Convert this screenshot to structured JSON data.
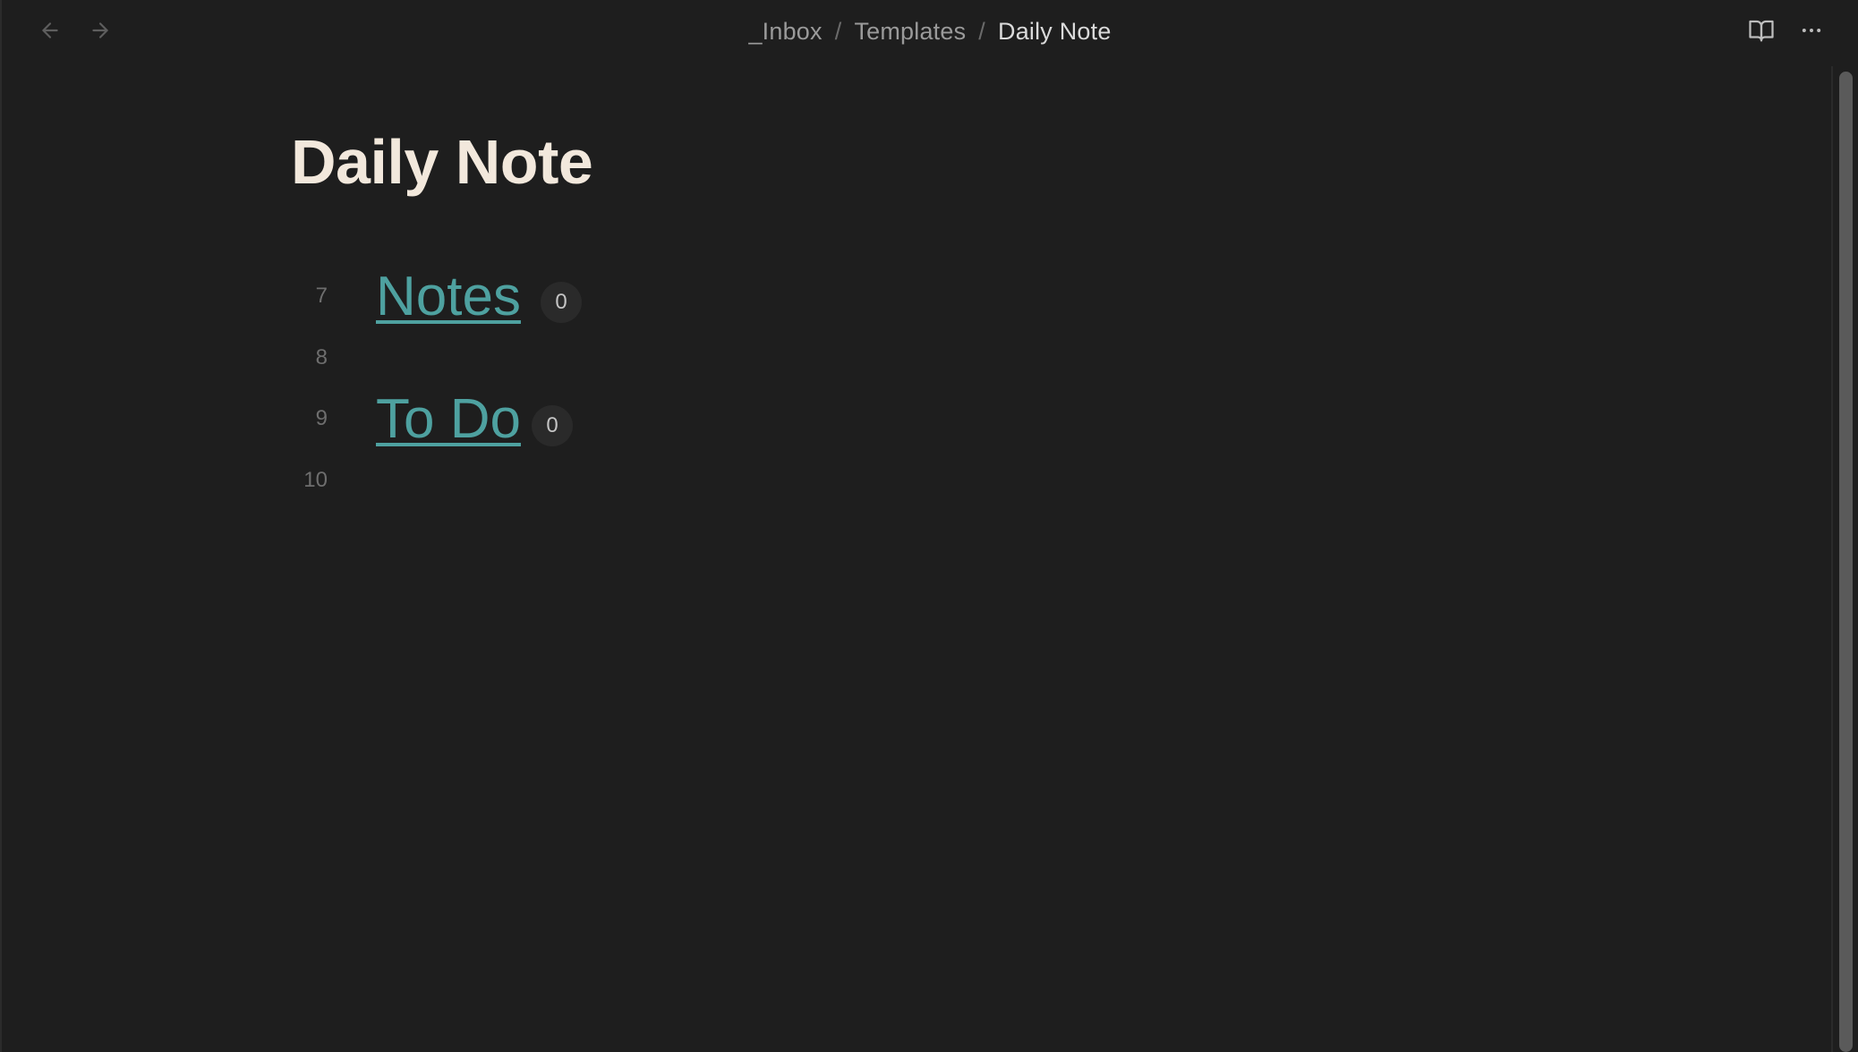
{
  "header": {
    "breadcrumb": [
      "_Inbox",
      "Templates",
      "Daily Note"
    ],
    "separator": "/",
    "icons": {
      "back": "arrow-left-icon",
      "forward": "arrow-right-icon",
      "reading_view": "book-open-icon",
      "more": "more-horizontal-icon"
    }
  },
  "note": {
    "title": "Daily Note",
    "lines": [
      {
        "number": "7",
        "heading": "Notes",
        "count": "0"
      },
      {
        "number": "8"
      },
      {
        "number": "9",
        "heading": "To Do",
        "count": "0"
      },
      {
        "number": "10"
      }
    ]
  },
  "colors": {
    "background": "#1e1e1e",
    "title": "#f2e8dc",
    "link": "#4ea1a0",
    "muted": "#6e6e6e"
  }
}
